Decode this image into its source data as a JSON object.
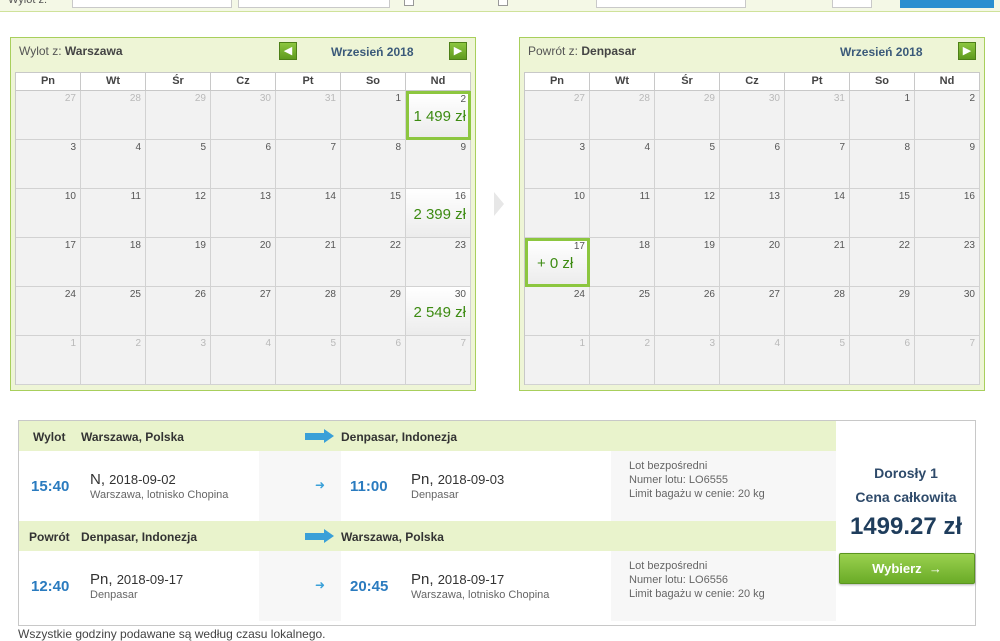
{
  "calendar_out": {
    "from_label": "Wylot z:",
    "city": "Warszawa",
    "month": "Wrzesień 2018",
    "weekdays": [
      "Pn",
      "Wt",
      "Śr",
      "Cz",
      "Pt",
      "So",
      "Nd"
    ],
    "days": [
      {
        "n": "27",
        "other": true
      },
      {
        "n": "28",
        "other": true
      },
      {
        "n": "29",
        "other": true
      },
      {
        "n": "30",
        "other": true
      },
      {
        "n": "31",
        "other": true
      },
      {
        "n": "1"
      },
      {
        "n": "2",
        "price": "1 499 zł",
        "selected": true
      },
      {
        "n": "3"
      },
      {
        "n": "4"
      },
      {
        "n": "5"
      },
      {
        "n": "6"
      },
      {
        "n": "7"
      },
      {
        "n": "8"
      },
      {
        "n": "9"
      },
      {
        "n": "10"
      },
      {
        "n": "11"
      },
      {
        "n": "12"
      },
      {
        "n": "13"
      },
      {
        "n": "14"
      },
      {
        "n": "15"
      },
      {
        "n": "16",
        "price": "2 399 zł"
      },
      {
        "n": "17"
      },
      {
        "n": "18"
      },
      {
        "n": "19"
      },
      {
        "n": "20"
      },
      {
        "n": "21"
      },
      {
        "n": "22"
      },
      {
        "n": "23"
      },
      {
        "n": "24"
      },
      {
        "n": "25"
      },
      {
        "n": "26"
      },
      {
        "n": "27"
      },
      {
        "n": "28"
      },
      {
        "n": "29"
      },
      {
        "n": "30",
        "price": "2 549 zł"
      },
      {
        "n": "1",
        "other": true
      },
      {
        "n": "2",
        "other": true
      },
      {
        "n": "3",
        "other": true
      },
      {
        "n": "4",
        "other": true
      },
      {
        "n": "5",
        "other": true
      },
      {
        "n": "6",
        "other": true
      },
      {
        "n": "7",
        "other": true
      }
    ]
  },
  "calendar_ret": {
    "from_label": "Powrót z:",
    "city": "Denpasar",
    "month": "Wrzesień 2018",
    "weekdays": [
      "Pn",
      "Wt",
      "Śr",
      "Cz",
      "Pt",
      "So",
      "Nd"
    ],
    "days": [
      {
        "n": "27",
        "other": true
      },
      {
        "n": "28",
        "other": true
      },
      {
        "n": "29",
        "other": true
      },
      {
        "n": "30",
        "other": true
      },
      {
        "n": "31",
        "other": true
      },
      {
        "n": "1"
      },
      {
        "n": "2"
      },
      {
        "n": "3"
      },
      {
        "n": "4"
      },
      {
        "n": "5"
      },
      {
        "n": "6"
      },
      {
        "n": "7"
      },
      {
        "n": "8"
      },
      {
        "n": "9"
      },
      {
        "n": "10"
      },
      {
        "n": "11"
      },
      {
        "n": "12"
      },
      {
        "n": "13"
      },
      {
        "n": "14"
      },
      {
        "n": "15"
      },
      {
        "n": "16"
      },
      {
        "n": "17",
        "price": "+ 0 zł",
        "selected": true
      },
      {
        "n": "18"
      },
      {
        "n": "19"
      },
      {
        "n": "20"
      },
      {
        "n": "21"
      },
      {
        "n": "22"
      },
      {
        "n": "23"
      },
      {
        "n": "24"
      },
      {
        "n": "25"
      },
      {
        "n": "26"
      },
      {
        "n": "27"
      },
      {
        "n": "28"
      },
      {
        "n": "29"
      },
      {
        "n": "30"
      },
      {
        "n": "1",
        "other": true
      },
      {
        "n": "2",
        "other": true
      },
      {
        "n": "3",
        "other": true
      },
      {
        "n": "4",
        "other": true
      },
      {
        "n": "5",
        "other": true
      },
      {
        "n": "6",
        "other": true
      },
      {
        "n": "7",
        "other": true
      }
    ]
  },
  "outbound": {
    "kind": "Wylot",
    "origin": "Warszawa, Polska",
    "destination": "Denpasar, Indonezja",
    "dep_time": "15:40",
    "dep_day": "N,",
    "dep_date": "2018-09-02",
    "dep_place": "Warszawa, lotnisko Chopina",
    "arr_time": "11:00",
    "arr_day": "Pn,",
    "arr_date": "2018-09-03",
    "arr_place": "Denpasar",
    "direct": "Lot bezpośredni",
    "flight_no": "Numer lotu: LO6555",
    "baggage": "Limit bagażu w cenie: 20 kg"
  },
  "inbound": {
    "kind": "Powrót",
    "origin": "Denpasar, Indonezja",
    "destination": "Warszawa, Polska",
    "dep_time": "12:40",
    "dep_day": "Pn,",
    "dep_date": "2018-09-17",
    "dep_place": "Denpasar",
    "arr_time": "20:45",
    "arr_day": "Pn,",
    "arr_date": "2018-09-17",
    "arr_place": "Warszawa, lotnisko Chopina",
    "direct": "Lot bezpośredni",
    "flight_no": "Numer lotu: LO6556",
    "baggage": "Limit bagażu w cenie: 20 kg"
  },
  "price": {
    "adult": "Dorosły 1",
    "total_label": "Cena całkowita",
    "total": "1499.27 zł",
    "choose_button": "Wybierz",
    "choose_arrow": "→"
  },
  "footnote": "Wszystkie godziny podawane są według czasu lokalnego.",
  "colors": {
    "accent_green": "#8cc63f",
    "price_green": "#3d8b12",
    "time_blue": "#2a7bbf",
    "arrow_blue": "#3aa0d8"
  }
}
